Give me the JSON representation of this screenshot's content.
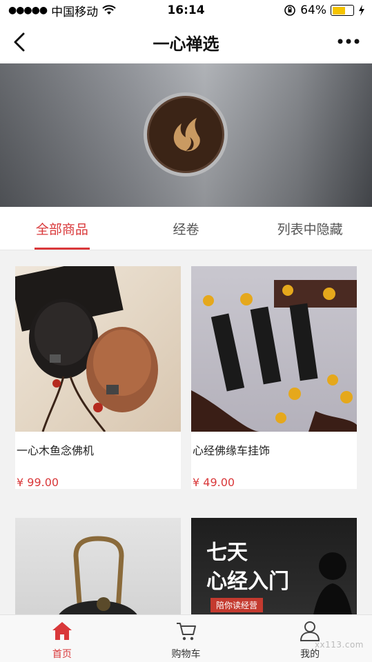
{
  "status_bar": {
    "signal": "●●●●●",
    "carrier": "中国移动",
    "time": "16:14",
    "battery": "64%",
    "battery_level": 0.64
  },
  "nav": {
    "title": "一心禅选"
  },
  "tabs": [
    {
      "label": "全部商品",
      "active": true
    },
    {
      "label": "经卷",
      "active": false
    },
    {
      "label": "列表中隐藏",
      "active": false
    }
  ],
  "products": [
    {
      "name": "一心木鱼念佛机",
      "price": "¥ 99.00"
    },
    {
      "name": "心经佛缘车挂饰",
      "price": "¥ 49.00"
    },
    {
      "name": "",
      "price": ""
    },
    {
      "name": "",
      "price": ""
    }
  ],
  "promo": {
    "line1": "七天",
    "line2": "心经入门",
    "sub": "陪你读经营"
  },
  "tabbar": [
    {
      "label": "首页",
      "icon": "home-icon",
      "active": true
    },
    {
      "label": "购物车",
      "icon": "cart-icon",
      "active": false
    },
    {
      "label": "我的",
      "icon": "user-icon",
      "active": false
    }
  ],
  "watermark": "xx113.com",
  "colors": {
    "accent": "#d9383a",
    "battery": "#f5c400"
  }
}
